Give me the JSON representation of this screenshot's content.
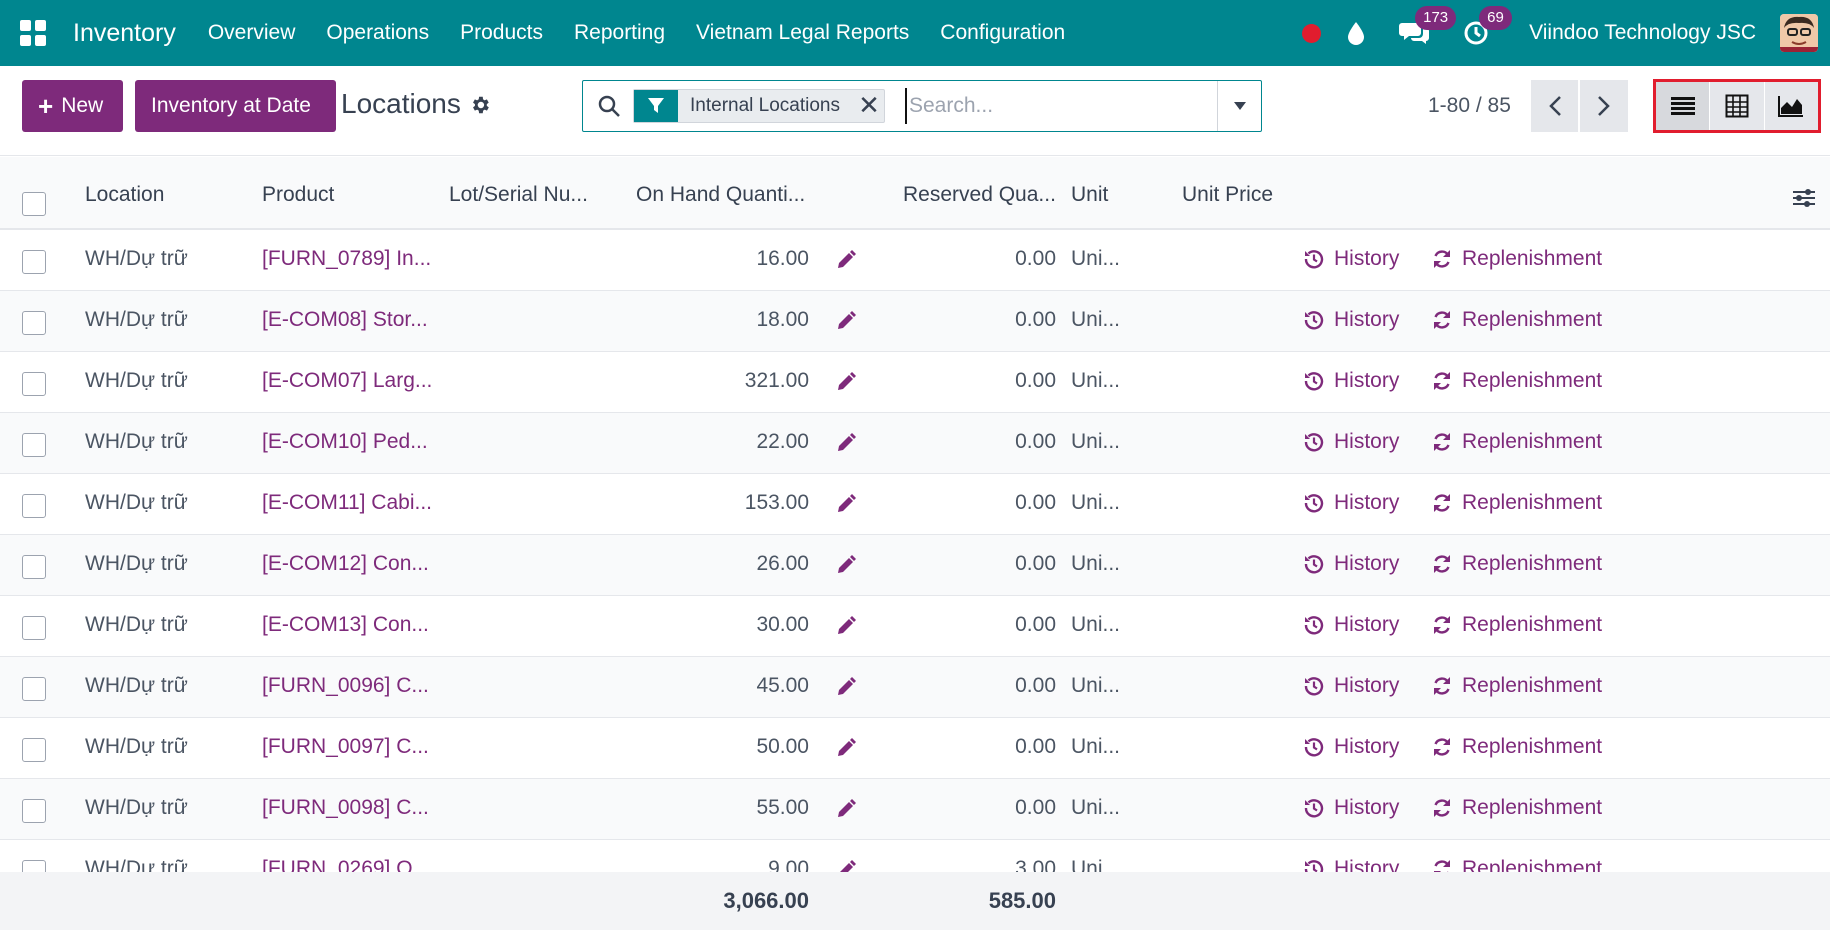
{
  "navbar": {
    "app_name": "Inventory",
    "menu": [
      "Overview",
      "Operations",
      "Products",
      "Reporting",
      "Vietnam Legal Reports",
      "Configuration"
    ],
    "messages_count": "173",
    "activities_count": "69",
    "company": "Viindoo Technology JSC"
  },
  "control": {
    "new_label": "New",
    "inventory_at_date_label": "Inventory at Date",
    "title": "Locations",
    "search": {
      "facet": "Internal Locations",
      "placeholder": "Search..."
    },
    "pager": "1-80 / 85"
  },
  "table": {
    "headers": {
      "location": "Location",
      "product": "Product",
      "lot": "Lot/Serial Nu...",
      "on_hand": "On Hand Quanti...",
      "reserved": "Reserved Qua...",
      "unit": "Unit",
      "unit_price": "Unit Price"
    },
    "history_label": "History",
    "replenishment_label": "Replenishment",
    "rows": [
      {
        "location": "WH/Dự trữ",
        "product": "[FURN_0789] In...",
        "on_hand": "16.00",
        "reserved": "0.00",
        "unit": "Uni..."
      },
      {
        "location": "WH/Dự trữ",
        "product": "[E-COM08] Stor...",
        "on_hand": "18.00",
        "reserved": "0.00",
        "unit": "Uni..."
      },
      {
        "location": "WH/Dự trữ",
        "product": "[E-COM07] Larg...",
        "on_hand": "321.00",
        "reserved": "0.00",
        "unit": "Uni..."
      },
      {
        "location": "WH/Dự trữ",
        "product": "[E-COM10] Ped...",
        "on_hand": "22.00",
        "reserved": "0.00",
        "unit": "Uni..."
      },
      {
        "location": "WH/Dự trữ",
        "product": "[E-COM11] Cabi...",
        "on_hand": "153.00",
        "reserved": "0.00",
        "unit": "Uni..."
      },
      {
        "location": "WH/Dự trữ",
        "product": "[E-COM12] Con...",
        "on_hand": "26.00",
        "reserved": "0.00",
        "unit": "Uni..."
      },
      {
        "location": "WH/Dự trữ",
        "product": "[E-COM13] Con...",
        "on_hand": "30.00",
        "reserved": "0.00",
        "unit": "Uni..."
      },
      {
        "location": "WH/Dự trữ",
        "product": "[FURN_0096] C...",
        "on_hand": "45.00",
        "reserved": "0.00",
        "unit": "Uni..."
      },
      {
        "location": "WH/Dự trữ",
        "product": "[FURN_0097] C...",
        "on_hand": "50.00",
        "reserved": "0.00",
        "unit": "Uni..."
      },
      {
        "location": "WH/Dự trữ",
        "product": "[FURN_0098] C...",
        "on_hand": "55.00",
        "reserved": "0.00",
        "unit": "Uni..."
      },
      {
        "location": "WH/Dự trữ",
        "product": "[FURN_0269] O...",
        "on_hand": "9.00",
        "reserved": "3.00",
        "unit": "Uni..."
      }
    ],
    "totals": {
      "on_hand": "3,066.00",
      "reserved": "585.00"
    }
  },
  "colors": {
    "navbar": "#00868F",
    "primary": "#7e2a7b",
    "highlight": "#e11d2e"
  }
}
